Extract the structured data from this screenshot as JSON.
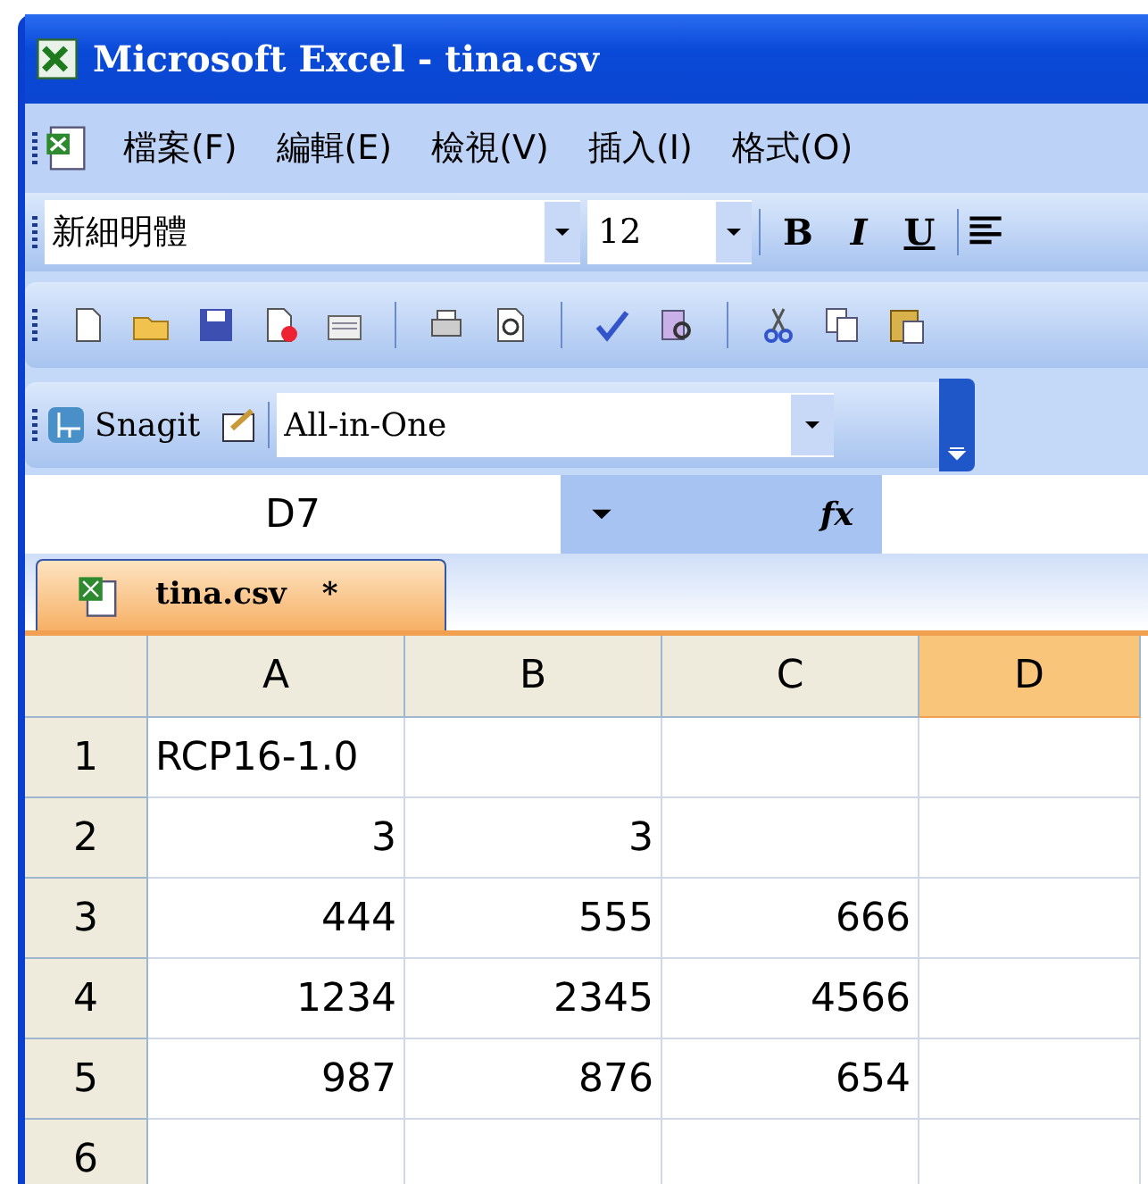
{
  "window": {
    "title": "Microsoft Excel - tina.csv"
  },
  "menu": [
    "檔案(F)",
    "編輯(E)",
    "檢視(V)",
    "插入(I)",
    "格式(O)"
  ],
  "format_toolbar": {
    "font": "新細明體",
    "size": "12",
    "bold": "B",
    "italic": "I",
    "underline": "U"
  },
  "snagit_toolbar": {
    "label": "Snagit",
    "profile": "All-in-One"
  },
  "formula_bar": {
    "name_box": "D7",
    "fx": "fx"
  },
  "sheet_tab": {
    "label": "tina.csv",
    "modified_mark": "*"
  },
  "table": {
    "columns": [
      {
        "label": "A",
        "selected": false
      },
      {
        "label": "B",
        "selected": false
      },
      {
        "label": "C",
        "selected": false
      },
      {
        "label": "D",
        "selected": true
      }
    ],
    "rows": [
      {
        "header": "1",
        "cells": [
          "RCP16-1.0",
          "",
          "",
          ""
        ]
      },
      {
        "header": "2",
        "cells": [
          "3",
          "3",
          "",
          ""
        ]
      },
      {
        "header": "3",
        "cells": [
          "444",
          "555",
          "666",
          ""
        ]
      },
      {
        "header": "4",
        "cells": [
          "1234",
          "2345",
          "4566",
          ""
        ]
      },
      {
        "header": "5",
        "cells": [
          "987",
          "876",
          "654",
          ""
        ]
      },
      {
        "header": "6",
        "cells": [
          "",
          "",
          "",
          ""
        ]
      }
    ]
  }
}
